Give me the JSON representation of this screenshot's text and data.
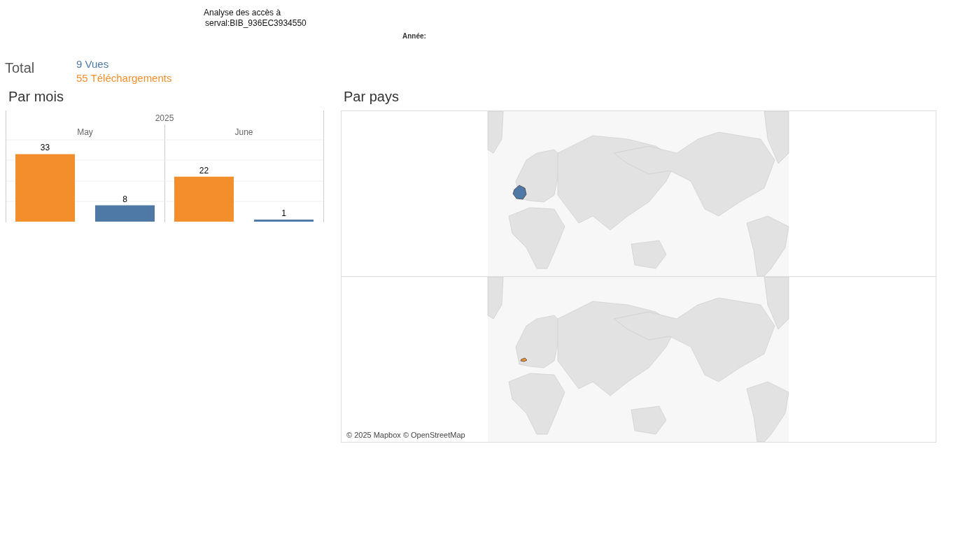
{
  "header": {
    "title_lines": [
      "Analyse des accès à",
      "serval:BIB_936EC3934550"
    ],
    "filter_label": "Année:"
  },
  "totals": {
    "label": "Total",
    "items": [
      {
        "text": "9 Vues",
        "color": "#4e79a7"
      },
      {
        "text": "55 Téléchargements",
        "color": "#f28e2b"
      }
    ]
  },
  "by_month": {
    "heading": "Par mois",
    "chart_data": {
      "type": "bar",
      "xlabel": "2025",
      "categories": [
        "May",
        "June"
      ],
      "series": [
        {
          "color": "#f28e2b",
          "values": [
            33,
            22
          ]
        },
        {
          "color": "#4e79a7",
          "values": [
            8,
            1
          ]
        }
      ],
      "ylim": [
        0,
        40
      ],
      "data_labels": true
    }
  },
  "by_country": {
    "heading": "Par pays",
    "maps": [
      {
        "color": "#4e79a7"
      },
      {
        "color": "#f28e2b"
      }
    ],
    "attribution": "© 2025 Mapbox © OpenStreetMap"
  }
}
